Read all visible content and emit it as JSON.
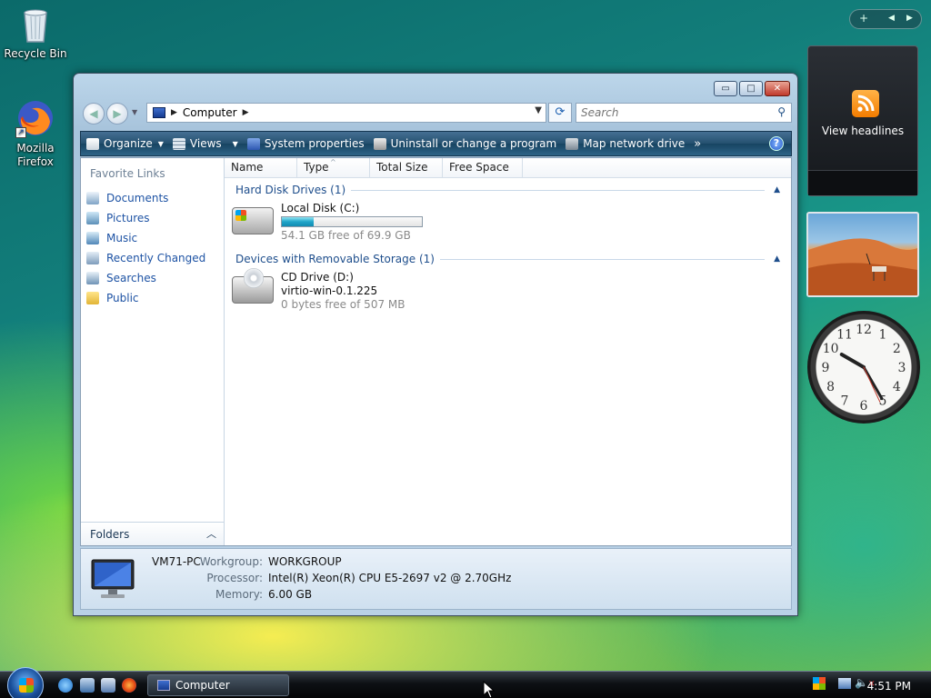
{
  "desktop": {
    "icons": [
      {
        "label": "Recycle Bin"
      },
      {
        "label": "Mozilla\nFirefox"
      }
    ]
  },
  "sidebar": {
    "feed_label": "View headlines",
    "clock": {
      "hours": [
        12,
        1,
        2,
        3,
        4,
        5,
        6,
        7,
        8,
        9,
        10,
        11
      ]
    }
  },
  "window": {
    "controls": {
      "minimize": "▭",
      "maximize": "□",
      "close": "✕"
    },
    "address": {
      "path": "Computer"
    },
    "search": {
      "placeholder": "Search"
    },
    "toolbar": {
      "organize": "Organize",
      "views": "Views",
      "system_properties": "System properties",
      "uninstall": "Uninstall or change a program",
      "map_drive": "Map network drive",
      "more": "»",
      "help": "?"
    },
    "nav": {
      "title": "Favorite Links",
      "items": [
        {
          "label": "Documents"
        },
        {
          "label": "Pictures"
        },
        {
          "label": "Music"
        },
        {
          "label": "Recently Changed"
        },
        {
          "label": "Searches"
        },
        {
          "label": "Public"
        }
      ],
      "folders": "Folders"
    },
    "columns": [
      "Name",
      "Type",
      "Total Size",
      "Free Space"
    ],
    "groups": [
      {
        "title": "Hard Disk Drives (1)",
        "drives": [
          {
            "name": "Local Disk (C:)",
            "free_text": "54.1 GB free of 69.9 GB",
            "used_fraction": 0.226
          }
        ]
      },
      {
        "title": "Devices with Removable Storage (1)",
        "drives": [
          {
            "name": "CD Drive (D:)",
            "label": "virtio-win-0.1.225",
            "free_text": "0 bytes free of 507 MB"
          }
        ]
      }
    ],
    "details": {
      "computer_name": "VM71-PC",
      "workgroup_label": "Workgroup:",
      "workgroup": "WORKGROUP",
      "processor_label": "Processor:",
      "processor": "Intel(R) Xeon(R) CPU E5-2697 v2 @ 2.70GHz",
      "memory_label": "Memory:",
      "memory": "6.00 GB"
    }
  },
  "taskbar": {
    "task_label": "Computer",
    "time": "4:51 PM"
  }
}
